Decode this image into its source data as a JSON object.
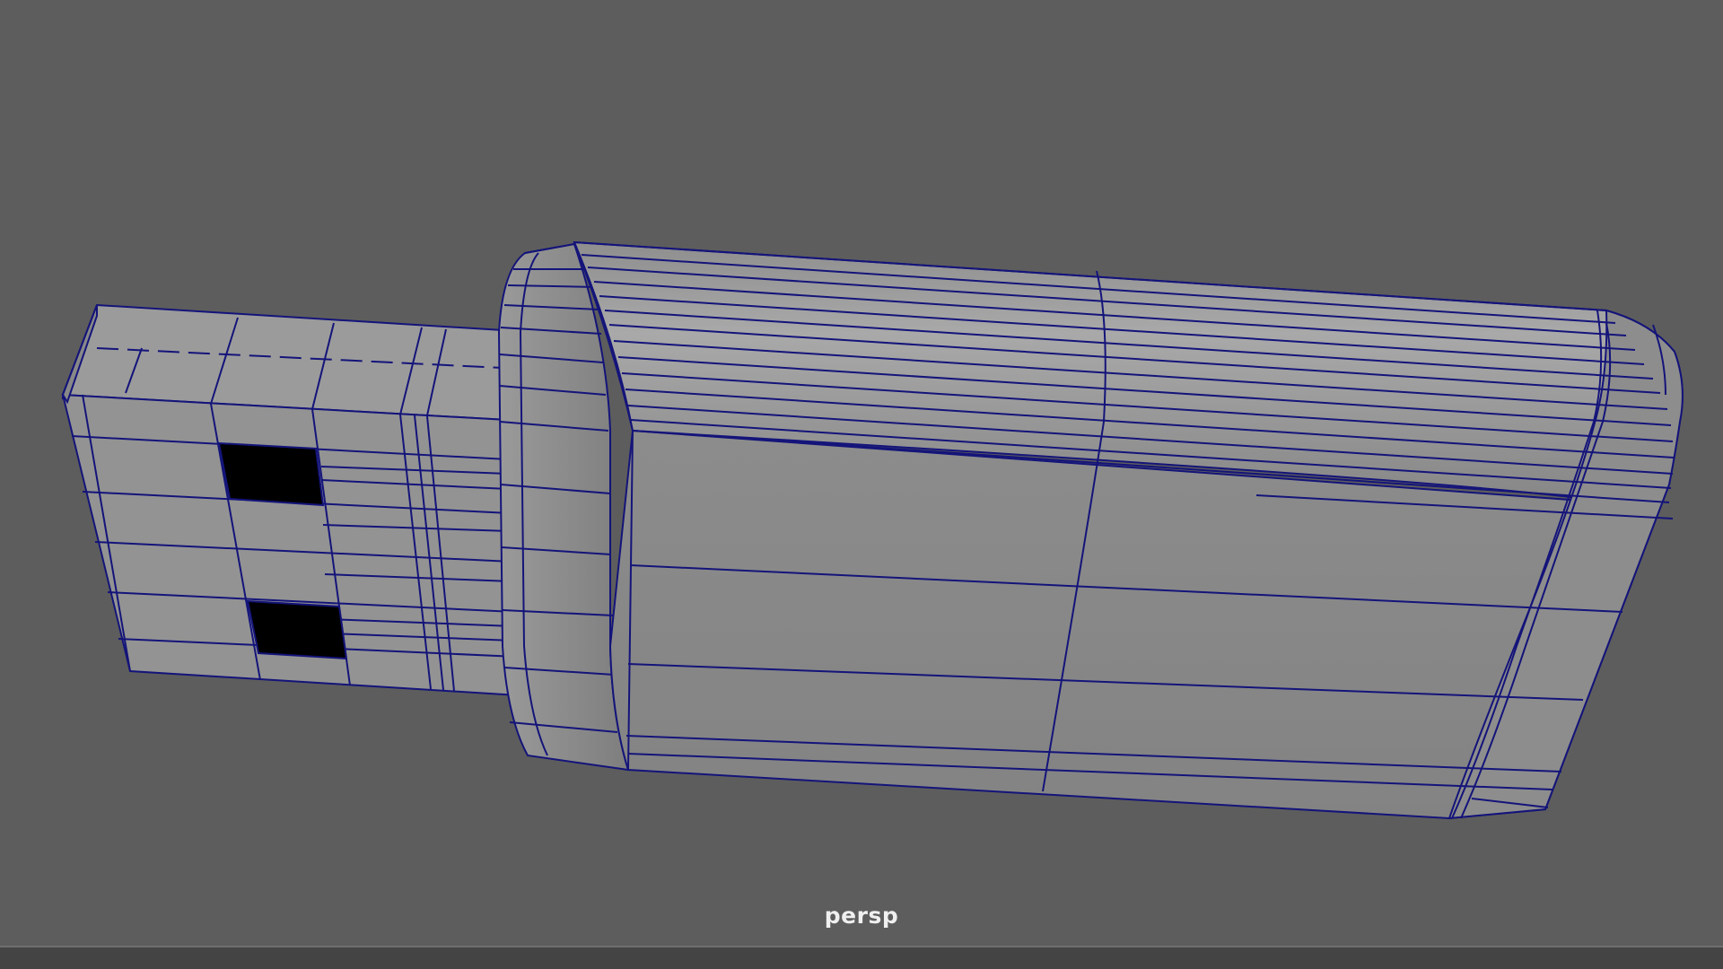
{
  "viewport": {
    "camera_name": "persp",
    "background_color": "#5d5d5d",
    "wireframe_color": "#14147a",
    "mesh_shade_color": "#9a9a9a"
  },
  "scene": {
    "object_description_icon": "usb-flash-drive-mesh-icon"
  }
}
